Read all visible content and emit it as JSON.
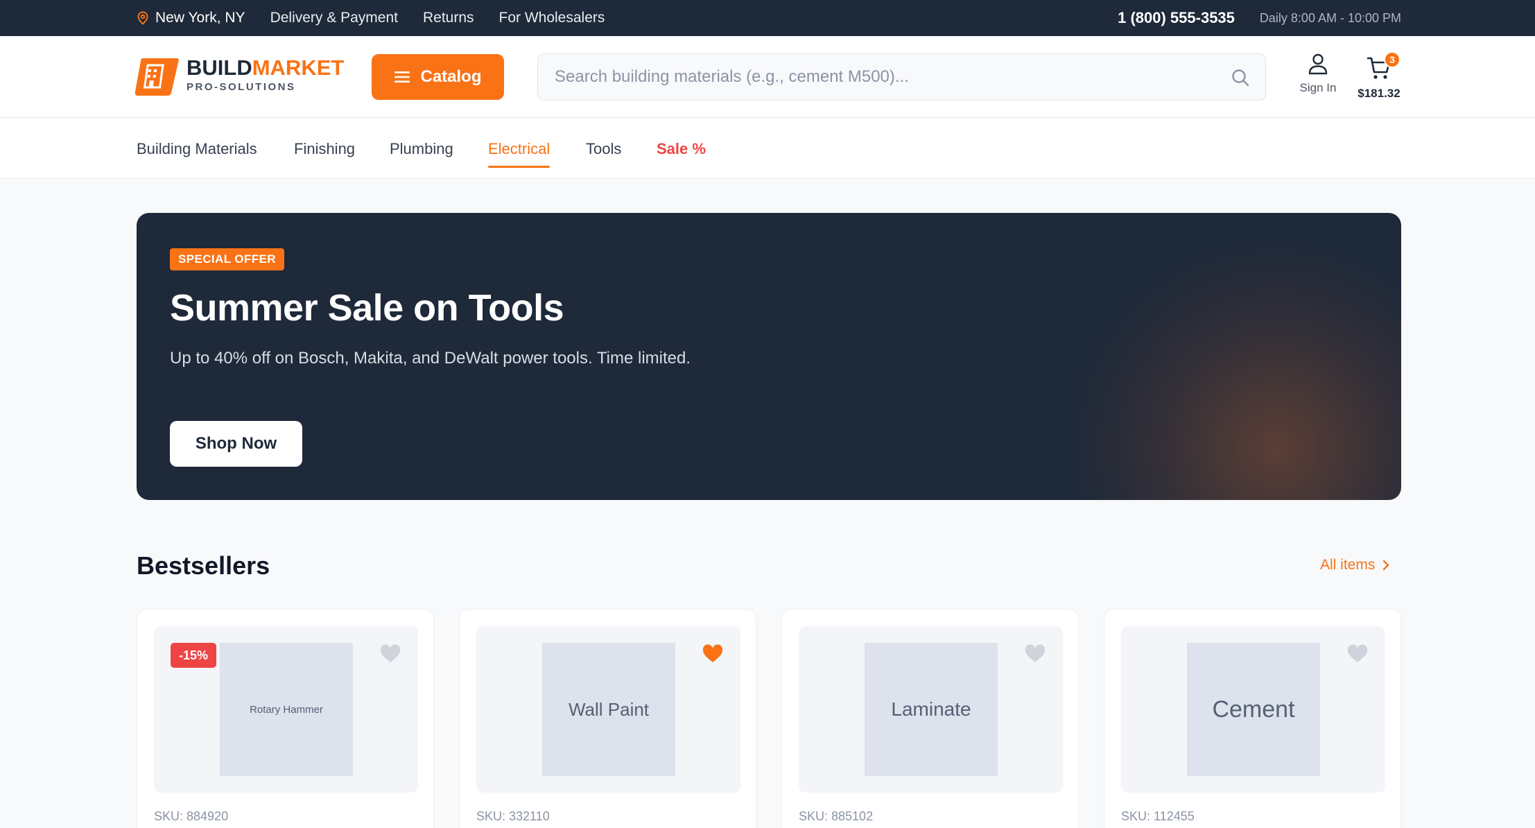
{
  "colors": {
    "accent": "#f97316",
    "dark": "#1e2939",
    "sale": "#ef4444"
  },
  "topbar": {
    "location": "New York, NY",
    "links": [
      "Delivery & Payment",
      "Returns",
      "For Wholesalers"
    ],
    "phone": "1 (800) 555-3535",
    "hours": "Daily 8:00 AM - 10:00 PM"
  },
  "header": {
    "logo_part1": "BUILD",
    "logo_part2": "MARKET",
    "logo_tagline": "PRO-SOLUTIONS",
    "catalog_label": "Catalog",
    "search_placeholder": "Search building materials (e.g., cement M500)...",
    "signin_label": "Sign In",
    "cart_count": "3",
    "cart_total": "$181.32"
  },
  "nav": {
    "items": [
      "Building Materials",
      "Finishing",
      "Plumbing",
      "Electrical",
      "Tools",
      "Sale %"
    ],
    "active": "Electrical"
  },
  "hero": {
    "tag": "SPECIAL OFFER",
    "title": "Summer Sale on Tools",
    "text": "Up to 40% off on Bosch, Makita, and DeWalt power tools. Time limited.",
    "cta": "Shop Now"
  },
  "bestsellers": {
    "title": "Bestsellers",
    "all_items": "All items",
    "products": [
      {
        "image_label": "Rotary Hammer",
        "discount": "-15%",
        "sku": "SKU: 884920",
        "favorite": false
      },
      {
        "image_label": "Wall Paint",
        "discount": "",
        "sku": "SKU: 332110",
        "favorite": true
      },
      {
        "image_label": "Laminate",
        "discount": "",
        "sku": "SKU: 885102",
        "favorite": false
      },
      {
        "image_label": "Cement",
        "discount": "",
        "sku": "SKU: 112455",
        "favorite": false
      }
    ]
  }
}
